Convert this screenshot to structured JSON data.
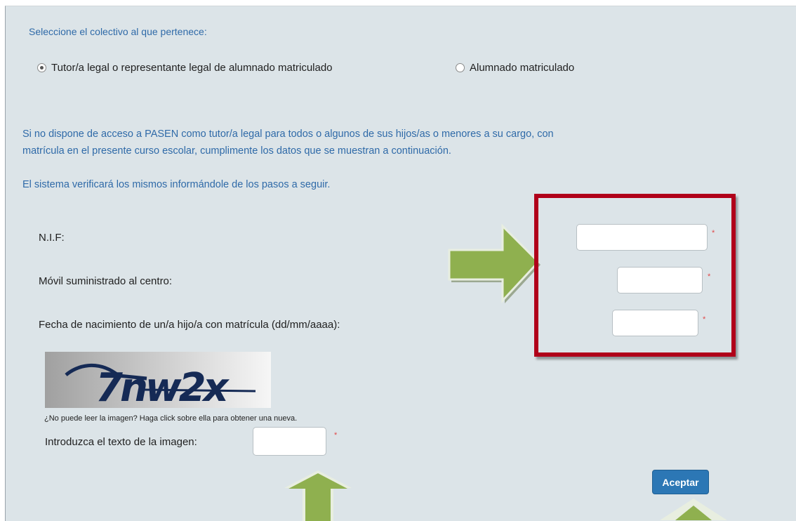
{
  "group_label": "Seleccione el colectivo al que pertenece:",
  "radio_options": [
    {
      "label": "Tutor/a legal o representante legal de alumnado matriculado",
      "selected": true
    },
    {
      "label": "Alumnado matriculado",
      "selected": false
    }
  ],
  "info_line1": "Si no dispone de acceso a PASEN como tutor/a legal para todos o algunos de sus hijos/as o menores a su cargo, con",
  "info_line2": "matrícula en el presente curso escolar, cumplimente los datos que se muestran a continuación.",
  "info_line3": "El sistema verificará los mismos informándole de los pasos a seguir.",
  "fields": {
    "nif_label": "N.I.F:",
    "nif_value": "",
    "movil_label": "Móvil suministrado al centro:",
    "movil_value": "",
    "fecha_label": "Fecha de nacimiento de un/a hijo/a con matrícula (dd/mm/aaaa):",
    "fecha_value": "",
    "required_mark": "*"
  },
  "captcha": {
    "image_text": "7nw2x",
    "hint": "¿No puede leer la imagen? Haga click sobre ella para obtener una nueva.",
    "input_label": "Introduzca el texto de la imagen:",
    "input_value": ""
  },
  "submit_label": "Aceptar",
  "colors": {
    "panel_bg": "#dce4e8",
    "link_blue": "#2f6aa8",
    "highlight_red": "#b0001a",
    "arrow_green": "#8fb04f",
    "button_blue": "#2c77b5"
  }
}
